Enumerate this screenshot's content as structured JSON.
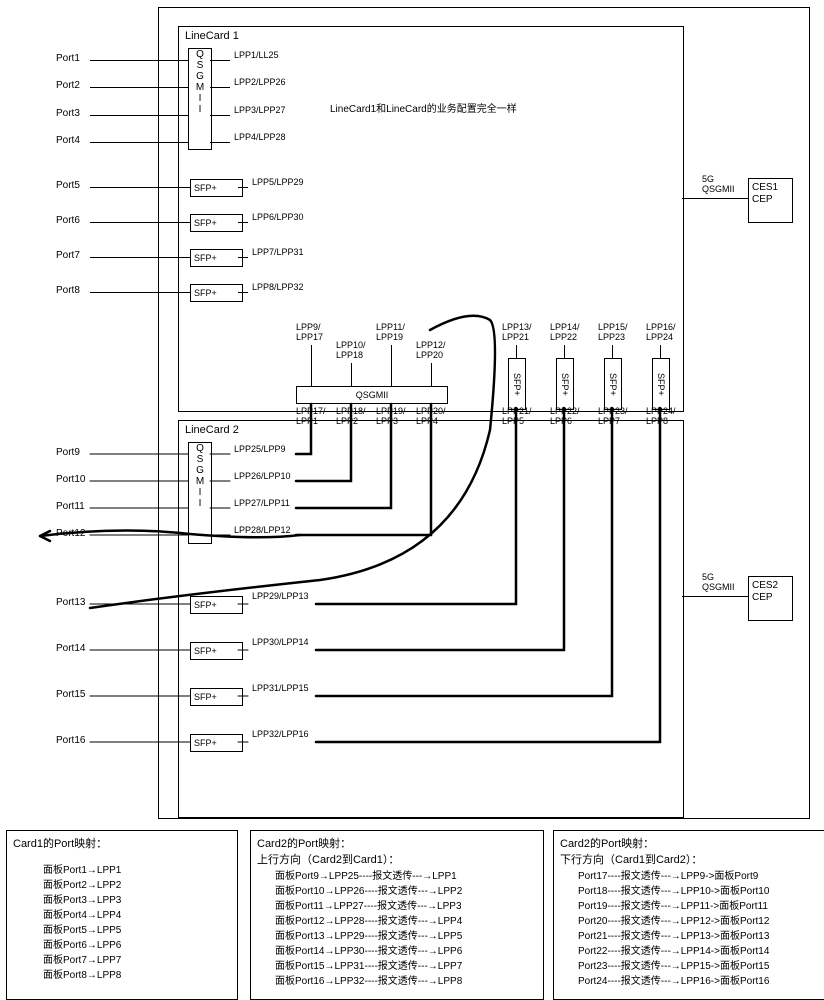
{
  "linecard1": {
    "title": "LineCard 1",
    "qsgmii": "QSGMII",
    "ports": [
      "Port1",
      "Port2",
      "Port3",
      "Port4",
      "Port5",
      "Port6",
      "Port7",
      "Port8"
    ],
    "lpp": [
      "LPP1/LL25",
      "LPP2/LPP26",
      "LPP3/LPP27",
      "LPP4/LPP28",
      "LPP5/LPP29",
      "LPP6/LPP30",
      "LPP7/LPP31",
      "LPP8/LPP32"
    ],
    "sfp": "SFP+"
  },
  "note": "LineCard1和LineCard的业务配置完全一样",
  "lpp_top": [
    "LPP9/\nLPP17",
    "LPP10/\nLPP18",
    "LPP11/\nLPP19",
    "LPP12/\nLPP20",
    "LPP13/\nLPP21",
    "LPP14/\nLPP22",
    "LPP15/\nLPP23",
    "LPP16/\nLPP24"
  ],
  "lpp_bot": [
    "LPP17/\nLPP1",
    "LPP18/\nLPP2",
    "LPP19/\nLPP3",
    "LPP20/\nLPP4",
    "LPP21/\nLPP5",
    "LPP22/\nLPP6",
    "LPP23/\nLPP7",
    "LPP24/\nLPP8"
  ],
  "qsgmii_label": "QSGMII",
  "linecard2": {
    "title": "LineCard 2",
    "qsgmii": "QSGMII",
    "ports": [
      "Port9",
      "Port10",
      "Port11",
      "Port12",
      "Port13",
      "Port14",
      "Port15",
      "Port16"
    ],
    "lpp": [
      "LPP25/LPP9",
      "LPP26/LPP10",
      "LPP27/LPP11",
      "LPP28/LPP12",
      "LPP29/LPP13",
      "LPP30/LPP14",
      "LPP31/LPP15",
      "LPP32/LPP16"
    ],
    "sfp": "SFP+"
  },
  "ces_link": "5G\nQSGMII",
  "ces1": "CES1\nCEP",
  "ces2": "CES2\nCEP",
  "tables": {
    "t1": {
      "hdr": "Card1的Port映射：",
      "rows": [
        "面板Port1→LPP1",
        "面板Port2→LPP2",
        "面板Port3→LPP3",
        "面板Port4→LPP4",
        "面板Port5→LPP5",
        "面板Port6→LPP6",
        "面板Port7→LPP7",
        "面板Port8→LPP8"
      ]
    },
    "t2": {
      "hdr": "Card2的Port映射：",
      "sub": "上行方向（Card2到Card1）：",
      "rows": [
        "面板Port9→LPP25----报文透传---→LPP1",
        "面板Port10→LPP26----报文透传---→LPP2",
        "面板Port11→LPP27----报文透传---→LPP3",
        "面板Port12→LPP28----报文透传---→LPP4",
        "面板Port13→LPP29----报文透传---→LPP5",
        "面板Port14→LPP30----报文透传---→LPP6",
        "面板Port15→LPP31----报文透传---→LPP7",
        "面板Port16→LPP32----报文透传---→LPP8"
      ]
    },
    "t3": {
      "hdr": "Card2的Port映射：",
      "sub": "下行方向（Card1到Card2）：",
      "rows": [
        "Port17----报文透传---→LPP9->面板Port9",
        "Port18----报文透传---→LPP10->面板Port10",
        "Port19----报文透传---→LPP11->面板Port11",
        "Port20----报文透传---→LPP12->面板Port12",
        "Port21----报文透传---→LPP13->面板Port13",
        "Port22----报文透传---→LPP14->面板Port14",
        "Port23----报文透传---→LPP15->面板Port15",
        "Port24----报文透传---→LPP16->面板Port16"
      ]
    }
  }
}
